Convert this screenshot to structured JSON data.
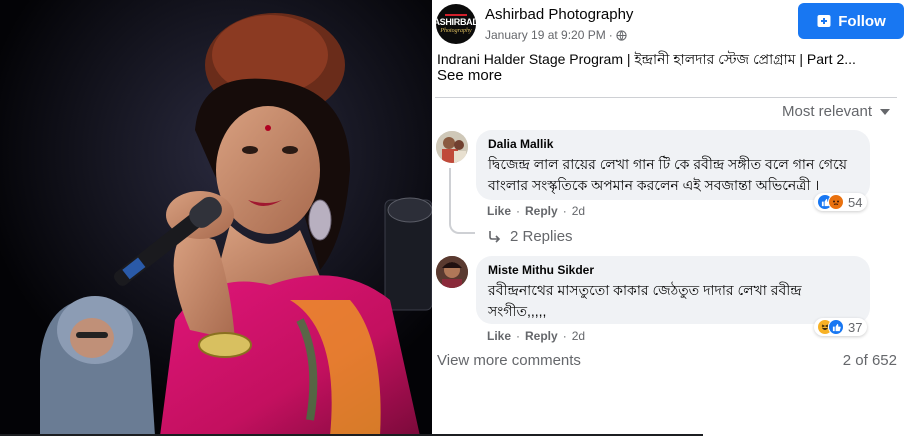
{
  "post": {
    "page_name": "Ashirbad Photography",
    "date": "January 19 at 9:20 PM",
    "separator": "·",
    "title": "Indrani Halder Stage Program | ইন্দ্রানী হালদার স্টেজ প্রোগ্রাম | Part 2...",
    "see_more": "See more",
    "follow_label": "Follow",
    "logo_text": "ASHIRBAD",
    "logo_sub": "Photography"
  },
  "sort_label": "Most relevant",
  "comments": [
    {
      "name": "Dalia Mallik",
      "text": "দ্বিজেন্দ্র লাল রায়ের লেখা গান টি কে রবীন্দ্র সঙ্গীত বলে গান গেয়ে বাংলার সংস্কৃতিকে অপমান করলেন এই সবজান্তা অভিনেত্রী ।",
      "like": "Like",
      "dot": "·",
      "reply": "Reply",
      "age": "2d",
      "reaction_count": "54",
      "reactions": [
        "like-icon",
        "angry-icon"
      ]
    },
    {
      "name": "Miste Mithu Sikder",
      "text": "রবীন্দ্রনাথের মাসতুতো কাকার জেঠতুত দাদার লেখা রবীন্দ্র সংগীত,,,,,",
      "like": "Like",
      "dot": "·",
      "reply": "Reply",
      "age": "2d",
      "reaction_count": "37",
      "reactions": [
        "haha-icon",
        "like-icon"
      ]
    }
  ],
  "replies_label": "2 Replies",
  "view_more_label": "View more comments",
  "count_label": "2 of 652",
  "colors": {
    "accent": "#1877f2",
    "muted": "#65676b",
    "bubble": "#f0f2f5"
  }
}
